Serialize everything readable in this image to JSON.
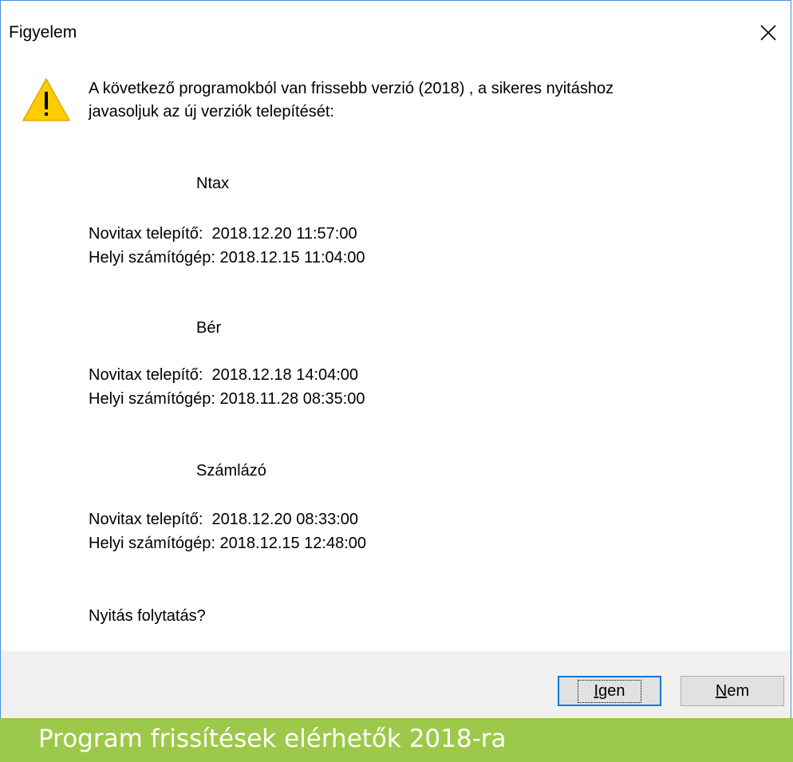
{
  "window": {
    "title": "Figyelem",
    "close_glyph": "×"
  },
  "dialog": {
    "icon": "warning-icon",
    "intro_line1": "A következő programokból van frissebb verzió (2018) , a sikeres nyitáshoz",
    "intro_line2": "javasoljuk az új verziók telepítését:",
    "programs": [
      {
        "name": "Ntax",
        "installer_label": "Novitax telepítő:",
        "installer_value": "2018.12.20 11:57:00",
        "local_label": "Helyi számítógép:",
        "local_value": "2018.12.15 11:04:00"
      },
      {
        "name": "Bér",
        "installer_label": "Novitax telepítő:",
        "installer_value": "2018.12.18 14:04:00",
        "local_label": "Helyi számítógép:",
        "local_value": "2018.11.28 08:35:00"
      },
      {
        "name": "Számlázó",
        "installer_label": "Novitax telepítő:",
        "installer_value": "2018.12.20 08:33:00",
        "local_label": "Helyi számítógép:",
        "local_value": "2018.12.15 12:48:00"
      }
    ],
    "question": "Nyitás folytatás?"
  },
  "buttons": {
    "yes_mnemonic": "I",
    "yes_rest": "gen",
    "no_mnemonic": "N",
    "no_rest": "em"
  },
  "banner": {
    "text": "Program frissítések elérhetők 2018-ra"
  },
  "colors": {
    "banner_bg": "#9dc94a",
    "footer_bg": "#f0f0f0",
    "warning_yellow": "#ffcc00",
    "default_button_border": "#0078d7"
  }
}
